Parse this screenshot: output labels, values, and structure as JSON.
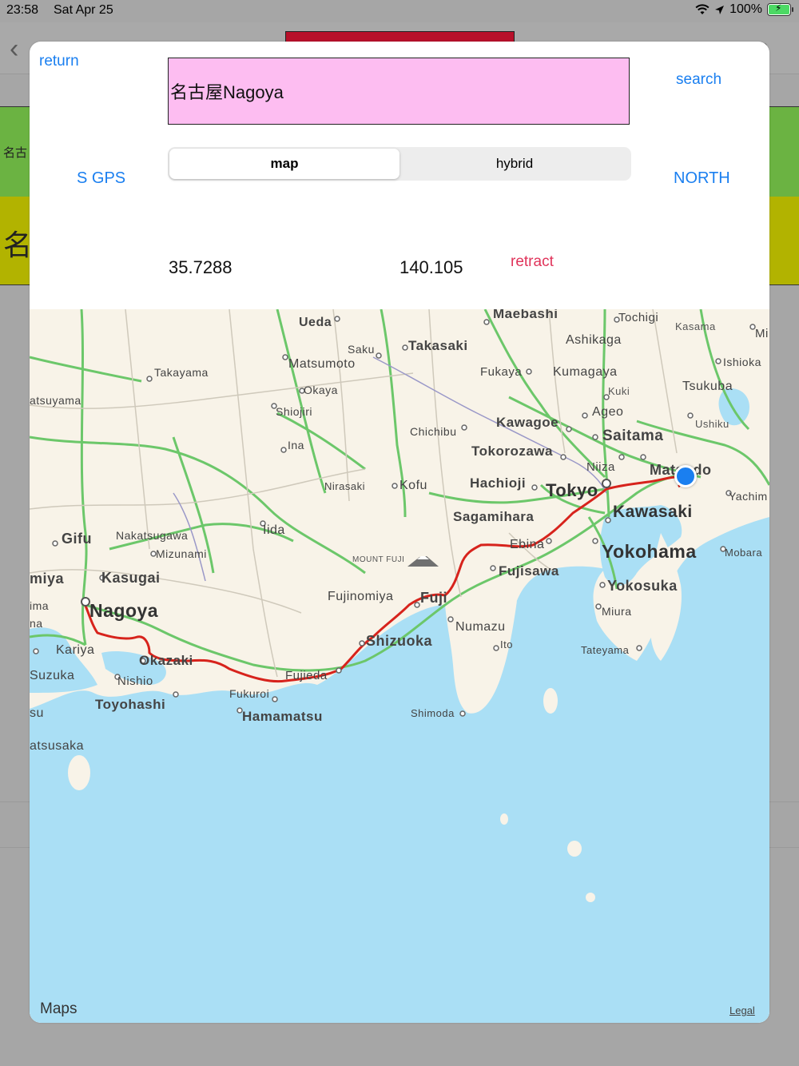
{
  "status_bar": {
    "time": "23:58",
    "date": "Sat Apr 25",
    "battery": "100%"
  },
  "background": {
    "green_row_text": "名古",
    "yellow_row_text": "名"
  },
  "modal": {
    "return_label": "return",
    "search_label": "search",
    "search_value": "名古屋Nagoya",
    "segments": [
      {
        "label": "map",
        "selected": true
      },
      {
        "label": "hybrid",
        "selected": false
      }
    ],
    "sgps_label": "S GPS",
    "north_label": "NORTH",
    "latitude": "35.7288",
    "longitude": "140.105",
    "retract_label": "retract"
  },
  "map": {
    "attribution": "Maps",
    "legal": "Legal",
    "colors": {
      "land": "#f8f3e8",
      "water": "#aadff5",
      "roads": "#6cc76a",
      "route": "#d7231c",
      "user_location": "#1a7ff0"
    },
    "labels": {
      "maebashi": "Maebashi",
      "tochigi": "Tochigi",
      "kasama": "Kasama",
      "mi": "Mi",
      "ueda": "Ueda",
      "saku": "Saku",
      "takasaki": "Takasaki",
      "ashikaga": "Ashikaga",
      "matsumoto": "Matsumoto",
      "takayama": "Takayama",
      "fukaya": "Fukaya",
      "kumagaya": "Kumagaya",
      "ishioka": "Ishioka",
      "okaya": "Okaya",
      "kuki": "Kuki",
      "tsukuba": "Tsukuba",
      "matsuyama": "atsuyama",
      "shiojiri": "Shiojiri",
      "ageo": "Ageo",
      "kawagoe": "Kawagoe",
      "ushiku": "Ushiku",
      "chichibu": "Chichibu",
      "saitama": "Saitama",
      "ina": "Ina",
      "tokorozawa": "Tokorozawa",
      "niiza": "Niiza",
      "matsudo": "Matsudo",
      "nirasaki": "Nirasaki",
      "kofu": "Kofu",
      "hachioji": "Hachioji",
      "tokyo": "Tokyo",
      "yachimata": "Yachim",
      "sagamihara": "Sagamihara",
      "kawasaki": "Kawasaki",
      "gifu": "Gifu",
      "nakatsugawa": "Nakatsugawa",
      "iida": "Iida",
      "ebina": "Ebina",
      "yokohama": "Yokohama",
      "mobara": "Mobara",
      "mizunami": "Mizunami",
      "mount_fuji": "MOUNT FUJI",
      "fujisawa": "Fujisawa",
      "ichinomiya": "miya",
      "kasugai": "Kasugai",
      "yokosuka": "Yokosuka",
      "fujinomiya": "Fujinomiya",
      "fuji": "Fuji",
      "nagoya": "Nagoya",
      "miura": "Miura",
      "ima": "ima",
      "numazu": "Numazu",
      "na": "na",
      "shizuoka": "Shizuoka",
      "ito": "Ito",
      "tateyama": "Tateyama",
      "kariya": "Kariya",
      "okazaki": "Okazaki",
      "suzuka": "Suzuka",
      "nishio": "Nishio",
      "fujieda": "Fujieda",
      "fukuroi": "Fukuroi",
      "toyohashi": "Toyohashi",
      "su": "su",
      "hamamatsu": "Hamamatsu",
      "shimoda": "Shimoda",
      "matsusaka": "atsusaka"
    }
  }
}
